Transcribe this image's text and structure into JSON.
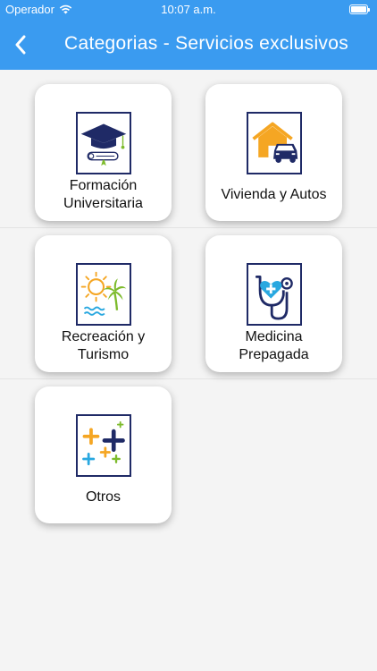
{
  "status_bar": {
    "carrier": "Operador",
    "time": "10:07 a.m."
  },
  "nav": {
    "title": "Categorias - Servicios exclusivos"
  },
  "categories": [
    {
      "label": "Formación Universitaria",
      "icon": "graduation-cap-icon"
    },
    {
      "label": "Vivienda y Autos",
      "icon": "house-car-icon"
    },
    {
      "label": "Recreación y Turismo",
      "icon": "sun-palm-icon"
    },
    {
      "label": "Medicina Prepagada",
      "icon": "stethoscope-icon"
    },
    {
      "label": "Otros",
      "icon": "plus-signs-icon"
    }
  ],
  "colors": {
    "header": "#3a9bf0",
    "icon_navy": "#1f2a66",
    "icon_orange": "#f5a623",
    "icon_blue": "#29a8e0",
    "icon_green": "#7dbb2c"
  }
}
